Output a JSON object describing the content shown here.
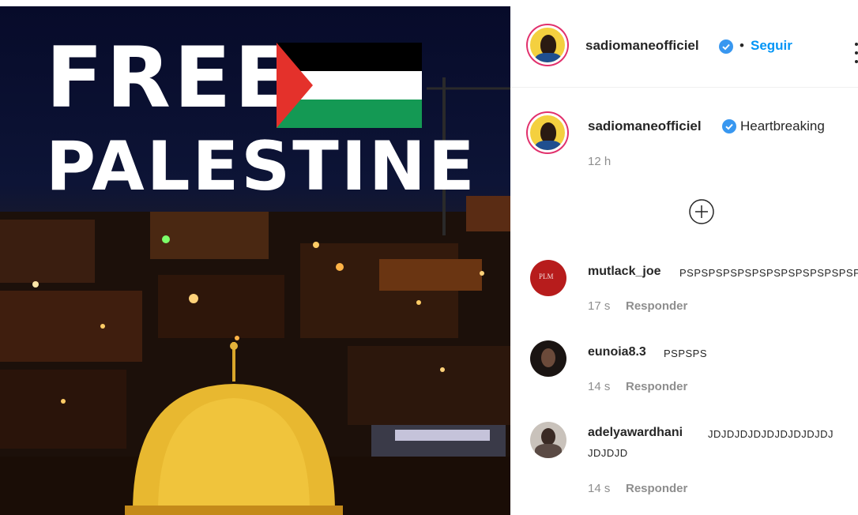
{
  "post": {
    "image": {
      "title_line1": "FREE",
      "title_line2": "PALESTINE",
      "flag_colors": {
        "black": "#000000",
        "white": "#ffffff",
        "green": "#149954",
        "red": "#e4312b"
      }
    }
  },
  "header": {
    "username": "sadiomaneofficiel",
    "separator": "•",
    "follow_label": "Seguir"
  },
  "caption": {
    "username": "sadiomaneofficiel",
    "text": "Heartbreaking",
    "time": "12 h"
  },
  "comments": [
    {
      "username": "mutlack_joe",
      "text": "PSPSPSPSPSPSPSPSPSPSPSPSPS",
      "time": "17 s",
      "reply_label": "Responder",
      "avatar_label": "PLM"
    },
    {
      "username": "eunoia8.3",
      "text": "PSPSPS",
      "time": "14 s",
      "reply_label": "Responder"
    },
    {
      "username": "adelyawardhani",
      "text": "JDJDJDJDJDJDJDJDJDJ",
      "text_line2": "JDJDJD",
      "time": "14 s",
      "reply_label": "Responder"
    }
  ],
  "colors": {
    "accent": "#0095f6",
    "verified": "#3897f0",
    "story_ring": "#e1306c"
  }
}
